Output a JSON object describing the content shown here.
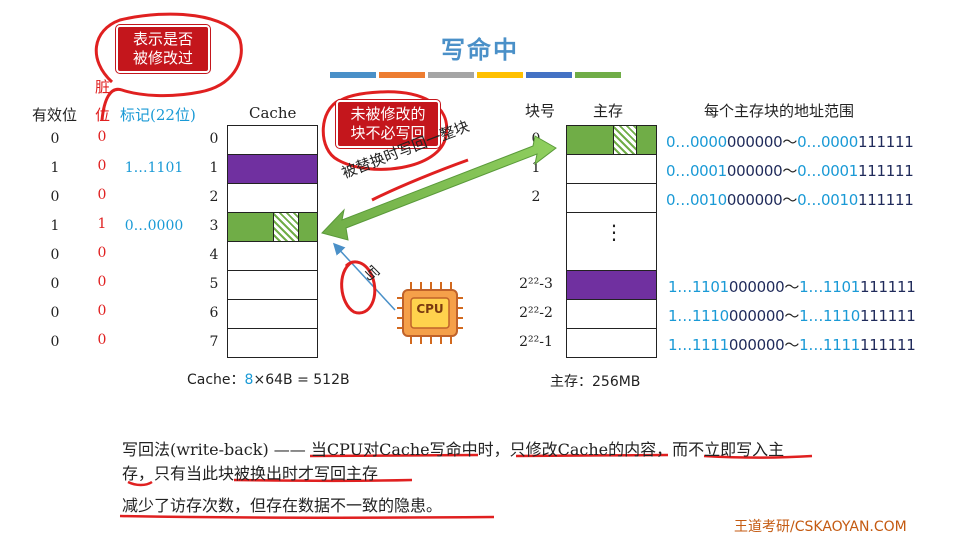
{
  "title": "写命中",
  "title_bar_colors": [
    "#4a90c8",
    "#ed7d31",
    "#a5a5a5",
    "#ffc000",
    "#4472c4",
    "#70ad47"
  ],
  "headers": {
    "valid": "有效位",
    "dirty_top": "脏",
    "dirty_bottom": "位",
    "tag": "标记(22位)",
    "cache": "Cache",
    "block_no": "块号",
    "main_mem": "主存",
    "addr_range": "每个主存块的地址范围"
  },
  "cache_lines": [
    {
      "index": "0",
      "valid": "0",
      "dirty": "0",
      "tag": ""
    },
    {
      "index": "1",
      "valid": "1",
      "dirty": "0",
      "tag": "1…1101"
    },
    {
      "index": "2",
      "valid": "0",
      "dirty": "0",
      "tag": ""
    },
    {
      "index": "3",
      "valid": "1",
      "dirty": "1",
      "tag": "0…0000"
    },
    {
      "index": "4",
      "valid": "0",
      "dirty": "0",
      "tag": ""
    },
    {
      "index": "5",
      "valid": "0",
      "dirty": "0",
      "tag": ""
    },
    {
      "index": "6",
      "valid": "0",
      "dirty": "0",
      "tag": ""
    },
    {
      "index": "7",
      "valid": "0",
      "dirty": "0",
      "tag": ""
    }
  ],
  "cache_caption": {
    "prefix": "Cache：",
    "highlight": "8",
    "suffix": "×64B = 512B"
  },
  "mem_blocks": [
    {
      "label": "0",
      "start_pre": "0…0000",
      "start_suf": "000000",
      "end_pre": "0…0000",
      "end_suf": "111111"
    },
    {
      "label": "1",
      "start_pre": "0…0001",
      "start_suf": "000000",
      "end_pre": "0…0001",
      "end_suf": "111111"
    },
    {
      "label": "2",
      "start_pre": "0…0010",
      "start_suf": "000000",
      "end_pre": "0…0010",
      "end_suf": "111111"
    },
    {
      "label": "2²²-3",
      "start_pre": "1…1101",
      "start_suf": "000000",
      "end_pre": "1…1101",
      "end_suf": "111111"
    },
    {
      "label": "2²²-2",
      "start_pre": "1…1110",
      "start_suf": "000000",
      "end_pre": "1…1110",
      "end_suf": "111111"
    },
    {
      "label": "2²²-1",
      "start_pre": "1…1111",
      "start_suf": "000000",
      "end_pre": "1…1111",
      "end_suf": "111111"
    }
  ],
  "tilde": "～",
  "mem_ellipsis": "⋮",
  "mem_caption": "主存：256MB",
  "callouts": {
    "dirty_meaning": [
      "表示是否",
      "被修改过"
    ],
    "not_modified": [
      "未被修改的",
      "块不必写回"
    ]
  },
  "arrow_labels": {
    "replace": "被替换时写回一整块",
    "write": "写"
  },
  "cpu_label": "CPU",
  "paragraph": {
    "line1": "写回法(write-back) —— 当CPU对Cache写命中时，只修改Cache的内容，而不立即写入主",
    "line2": "存，只有当此块被换出时才写回主存",
    "line3": "减少了访存次数，但存在数据不一致的隐患。"
  },
  "footer": "王道考研/CSKAOYAN.COM",
  "colors": {
    "accent_blue": "#4a90c8",
    "red": "#c4161c",
    "dirty_red": "#e02020",
    "tag_blue": "#1a9ad6",
    "green": "#70ad47",
    "purple": "#7030a0",
    "addr_blue": "#1a9ad6",
    "addr_dark": "#1f2a5a",
    "footer": "#c45a11"
  }
}
